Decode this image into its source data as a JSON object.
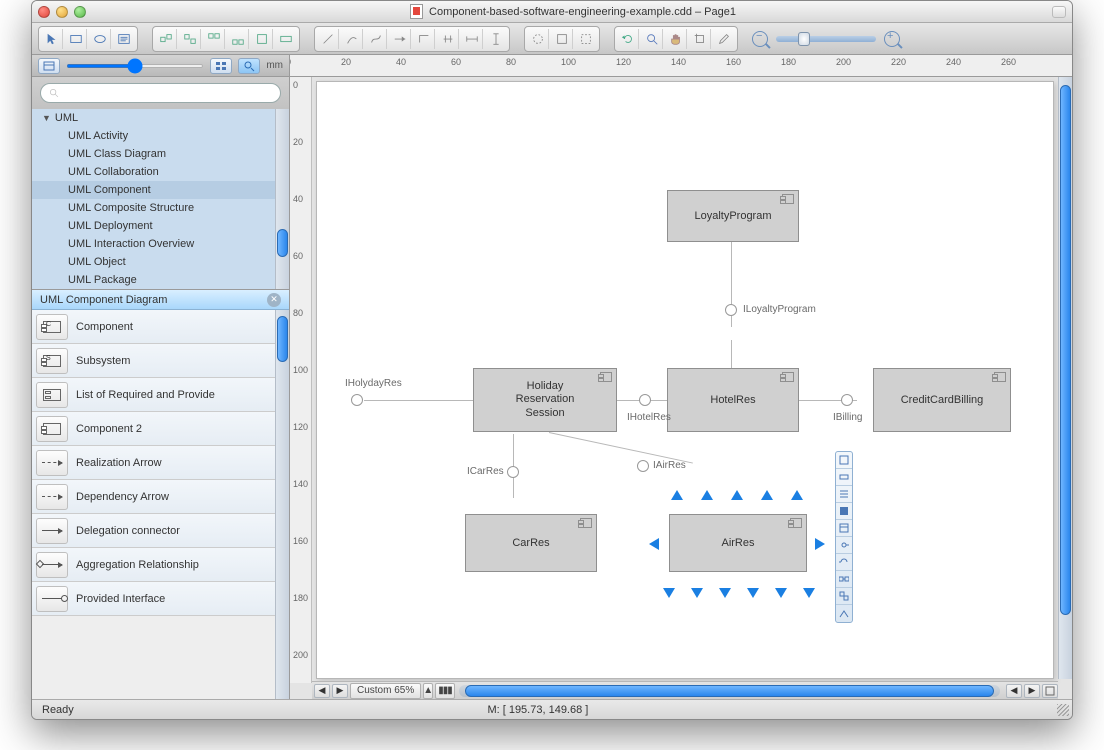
{
  "title": "Component-based-software-engineering-example.cdd – Page1",
  "ruler_unit": "mm",
  "ruler_ticks_h": [
    "0",
    "20",
    "40",
    "60",
    "80",
    "100",
    "120",
    "140",
    "160",
    "180",
    "200",
    "220",
    "240",
    "260"
  ],
  "ruler_ticks_v": [
    "0",
    "20",
    "40",
    "60",
    "80",
    "100",
    "120",
    "140",
    "160",
    "180",
    "200"
  ],
  "search": {
    "placeholder": ""
  },
  "tree": {
    "root": "UML",
    "items": [
      "UML Activity",
      "UML Class Diagram",
      "UML Collaboration",
      "UML Component",
      "UML Composite Structure",
      "UML Deployment",
      "UML Interaction Overview",
      "UML Object",
      "UML Package"
    ],
    "selected_index": 3
  },
  "section_header": "UML Component Diagram",
  "stencils": [
    "Component",
    "Subsystem",
    "List of Required and Provide",
    "Component 2",
    "Realization Arrow",
    "Dependency Arrow",
    "Delegation connector",
    "Aggregation Relationship",
    "Provided Interface"
  ],
  "diagram": {
    "components": {
      "loyalty": "LoyaltyProgram",
      "holiday": "Holiday Reservation Session",
      "hotel": "HotelRes",
      "credit": "CreditCardBilling",
      "car": "CarRes",
      "air": "AirRes"
    },
    "interfaces": {
      "iloyalty": "ILoyaltyProgram",
      "iholiday": "IHolydayRes",
      "ihotel": "IHotelRes",
      "ibilling": "IBilling",
      "icar": "ICarRes",
      "iair": "IAirRes"
    }
  },
  "bottom": {
    "zoom_label": "Custom 65%"
  },
  "status": {
    "left": "Ready",
    "center": "M: [ 195.73, 149.68 ]"
  }
}
